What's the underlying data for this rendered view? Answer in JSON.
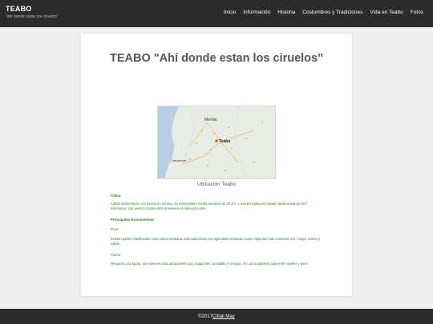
{
  "header": {
    "brand": "TEABO",
    "tagline": "\"ahi donde estan los ciruelos\"",
    "nav": [
      "Inicio",
      "Información",
      "Historia",
      "Costumbres y Tradiciones",
      "Vida en Teabo",
      "Fotos"
    ]
  },
  "page": {
    "title": "TEABO \"Ahí donde estan los ciruelos\""
  },
  "map": {
    "caption": "Ubicación Teabo",
    "labels": {
      "merida": "Mérida",
      "teabo": "Teabo",
      "campeche": "Campeche"
    }
  },
  "sections": {
    "clima_heading": "Clima",
    "clima_text": "Cálido subhúmedo, con lluvias en verano. Su temperatura media anual es de 26.3°C y una precipitación pluvial media anual de 65.7 milímetros. Los vientos dominantes provienen en dirección este.",
    "ecosistemas_heading": "Principales Ecosistemas",
    "flora_heading": "Flora",
    "flora_text": "Existen partes clasificadas como selva mediana, sub-caducifolia con agricultura nómada, cuyas especies más comunes son: chaya, ramón y sabila.",
    "fauna_heading": "Fauna",
    "fauna_text": "Respecto a la fauna, las especies más abundantes son: mapaches, armadillo y conejos. Así como diversas clases de reptiles y aves."
  },
  "footer": {
    "prefix": "©2017",
    "author": "Citlali May"
  },
  "colors": {
    "topbar": "#2b2b2b",
    "accent_text": "#2e7d32",
    "background": "#eeeeee"
  }
}
